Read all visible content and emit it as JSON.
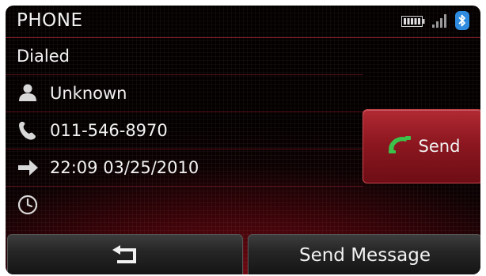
{
  "header": {
    "title": "PHONE",
    "status_icons": [
      "battery-icon",
      "signal-icon",
      "bluetooth-icon"
    ]
  },
  "call_details": {
    "type_label": "Dialed",
    "contact_name": "Unknown",
    "phone_number": "011-546-8970",
    "datetime": "22:09 03/25/2010",
    "duration": ""
  },
  "buttons": {
    "send_label": "Send",
    "send_message_label": "Send Message",
    "back_icon": "back-arrow-icon"
  },
  "colors": {
    "accent_red": "#8d1720",
    "send_phone_icon": "#3cc24a",
    "bluetooth_badge": "#2f8be0",
    "text": "#f2f2f2"
  }
}
